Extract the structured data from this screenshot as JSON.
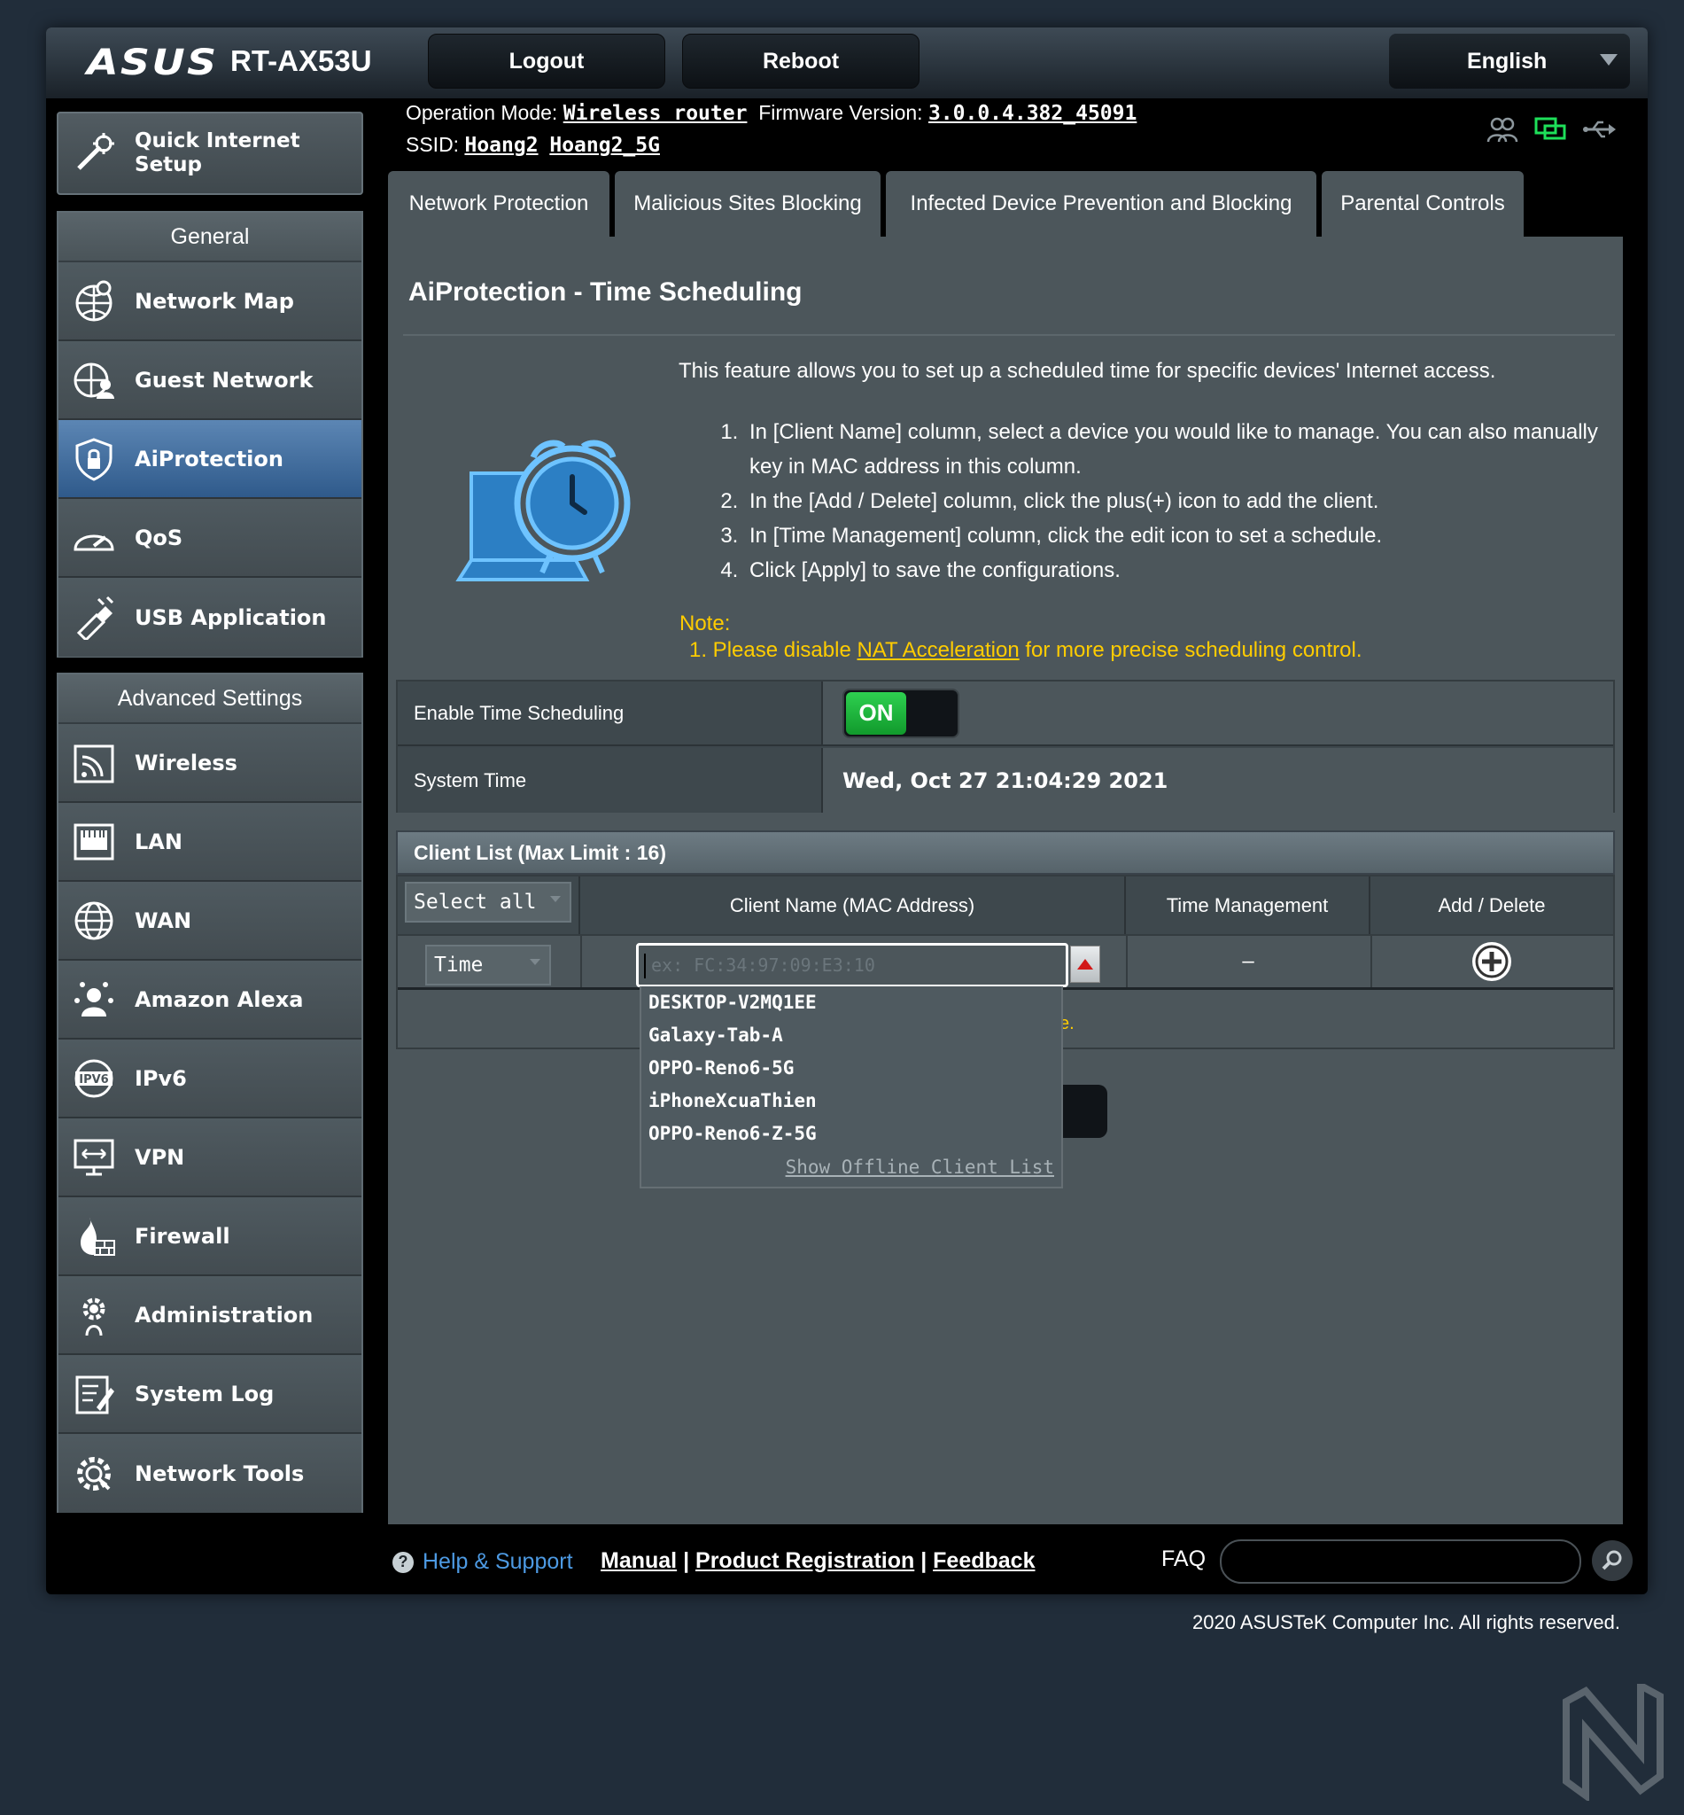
{
  "header": {
    "brand": "ASUS",
    "model": "RT-AX53U",
    "logout_label": "Logout",
    "reboot_label": "Reboot",
    "language": "English"
  },
  "info": {
    "operation_mode_label": "Operation Mode:",
    "operation_mode": "Wireless router",
    "firmware_label": "Firmware Version:",
    "firmware": "3.0.0.4.382_45091",
    "ssid_label": "SSID:",
    "ssid_1": "Hoang2",
    "ssid_2": "Hoang2_5G"
  },
  "sidebar": {
    "quick_setup": "Quick Internet Setup",
    "general_header": "General",
    "general_items": [
      {
        "label": "Network Map",
        "icon": "network-map-icon"
      },
      {
        "label": "Guest Network",
        "icon": "guest-network-icon"
      },
      {
        "label": "AiProtection",
        "icon": "aiprotection-icon",
        "active": true
      },
      {
        "label": "QoS",
        "icon": "qos-icon"
      },
      {
        "label": "USB Application",
        "icon": "usb-application-icon"
      }
    ],
    "advanced_header": "Advanced Settings",
    "advanced_items": [
      {
        "label": "Wireless",
        "icon": "wireless-icon"
      },
      {
        "label": "LAN",
        "icon": "lan-icon"
      },
      {
        "label": "WAN",
        "icon": "wan-icon"
      },
      {
        "label": "Amazon Alexa",
        "icon": "alexa-icon"
      },
      {
        "label": "IPv6",
        "icon": "ipv6-icon"
      },
      {
        "label": "VPN",
        "icon": "vpn-icon"
      },
      {
        "label": "Firewall",
        "icon": "firewall-icon"
      },
      {
        "label": "Administration",
        "icon": "administration-icon"
      },
      {
        "label": "System Log",
        "icon": "system-log-icon"
      },
      {
        "label": "Network Tools",
        "icon": "network-tools-icon"
      }
    ]
  },
  "tabs": [
    {
      "label": "Network Protection"
    },
    {
      "label": "Malicious Sites Blocking"
    },
    {
      "label": "Infected Device Prevention and Blocking"
    },
    {
      "label": "Parental Controls"
    }
  ],
  "main": {
    "title": "AiProtection - Time Scheduling",
    "description": "This feature allows you to set up a scheduled time for specific devices' Internet access.",
    "steps": [
      "In [Client Name] column, select a device you would like to manage. You can also manually key in MAC address in this column.",
      "In the [Add / Delete] column, click the plus(+) icon to add the client.",
      "In [Time Management] column, click the edit icon to set a schedule.",
      "Click [Apply] to save the configurations."
    ],
    "note_label": "Note:",
    "note_prefix": "1. Please disable ",
    "note_link": "NAT Acceleration",
    "note_suffix": " for more precise scheduling control."
  },
  "settings": {
    "enable_label": "Enable Time Scheduling",
    "enable_value": "ON",
    "system_time_label": "System Time",
    "system_time": "Wed, Oct 27 21:04:29 2021"
  },
  "client_list": {
    "title": "Client List (Max Limit : 16)",
    "select_all": "Select all",
    "col_client_name": "Client Name (MAC Address)",
    "col_time_management": "Time Management",
    "col_add_delete": "Add / Delete",
    "row_mode": "Time",
    "mac_placeholder": "ex: FC:34:97:09:E3:10",
    "time_management_value": "–",
    "hint_fragment": "e.",
    "dropdown_items": [
      "DESKTOP-V2MQ1EE",
      "Galaxy-Tab-A",
      "OPPO-Reno6-5G",
      "iPhoneXcuaThien",
      "OPPO-Reno6-Z-5G"
    ],
    "show_offline": "Show Offline Client List"
  },
  "footer": {
    "help_support": "Help & Support",
    "manual": "Manual",
    "product_registration": "Product Registration",
    "feedback": "Feedback",
    "faq": "FAQ",
    "copyright": "2020 ASUSTeK Computer Inc. All rights reserved."
  },
  "colors": {
    "accent_blue": "#2f5a8b",
    "toggle_on": "#1fb53e",
    "note_yellow": "#ffcc00",
    "help_blue": "#4d9ae3"
  }
}
